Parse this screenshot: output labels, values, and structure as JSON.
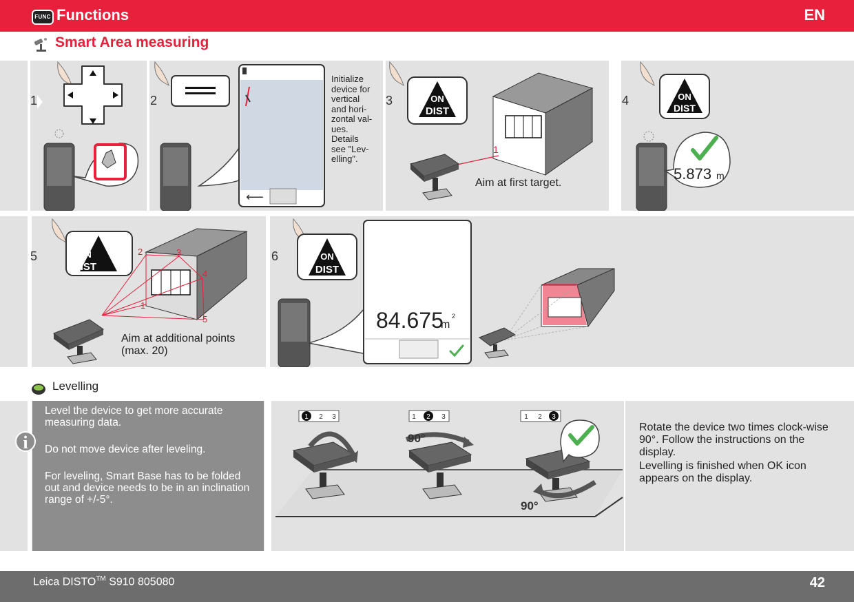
{
  "header": {
    "badge": "FUNC",
    "title": "Functions",
    "language": "EN",
    "color": "#e8203b"
  },
  "section": {
    "title": "Smart Area measuring",
    "icon": "smart-base-icon"
  },
  "steps": [
    {
      "number": "1",
      "icon": "navigation-pad-icon",
      "bubble_icon": "area-function-icon"
    },
    {
      "number": "2",
      "icon": "menu-button-icon",
      "note": [
        "Initialize",
        "device for",
        "vertical",
        "and hori-",
        "zontal val-",
        "ues.",
        "Details",
        "see \"Lev-",
        "elling\"."
      ]
    },
    {
      "number": "3",
      "button": {
        "top": "ON",
        "bottom": "DIST"
      },
      "caption": "Aim at first target.",
      "point_labels": [
        "1"
      ]
    },
    {
      "number": "4",
      "button": {
        "top": "ON",
        "bottom": "DIST"
      },
      "reading": {
        "value": "5.873",
        "unit": "m"
      }
    },
    {
      "number": "5",
      "button": {
        "top": "ON",
        "bottom": "DIST"
      },
      "caption_lines": [
        "Aim at additional points",
        "(max. 20)"
      ],
      "point_labels": [
        "1",
        "2",
        "3",
        "4",
        "5"
      ]
    },
    {
      "number": "6",
      "button": {
        "top": "ON",
        "bottom": "DIST"
      },
      "reading": {
        "value": "84.675",
        "unit": "m",
        "exponent": "2"
      }
    }
  ],
  "levelling": {
    "title": "Levelling",
    "info_paragraphs": [
      "Level the device to get more accurate measuring data.",
      "Do not move device after leveling.",
      "For leveling, Smart Base has to be folded out and device needs to be in an inclination range of +/-5°."
    ],
    "stage_indicators": [
      {
        "labels": [
          "1",
          "2",
          "3"
        ],
        "active": "1"
      },
      {
        "labels": [
          "1",
          "2",
          "3"
        ],
        "active": "2"
      },
      {
        "labels": [
          "1",
          "2",
          "3"
        ],
        "active": "3"
      }
    ],
    "rotation_labels": [
      "90°",
      "90°"
    ],
    "instructions": [
      "Rotate the device two times clock-wise 90°. Follow the instructions on the display.",
      "Levelling is finished when OK icon appears on the display."
    ]
  },
  "footer": {
    "product": "Leica DISTO",
    "trademark": "TM",
    "model": " S910 805080",
    "page": "42"
  }
}
